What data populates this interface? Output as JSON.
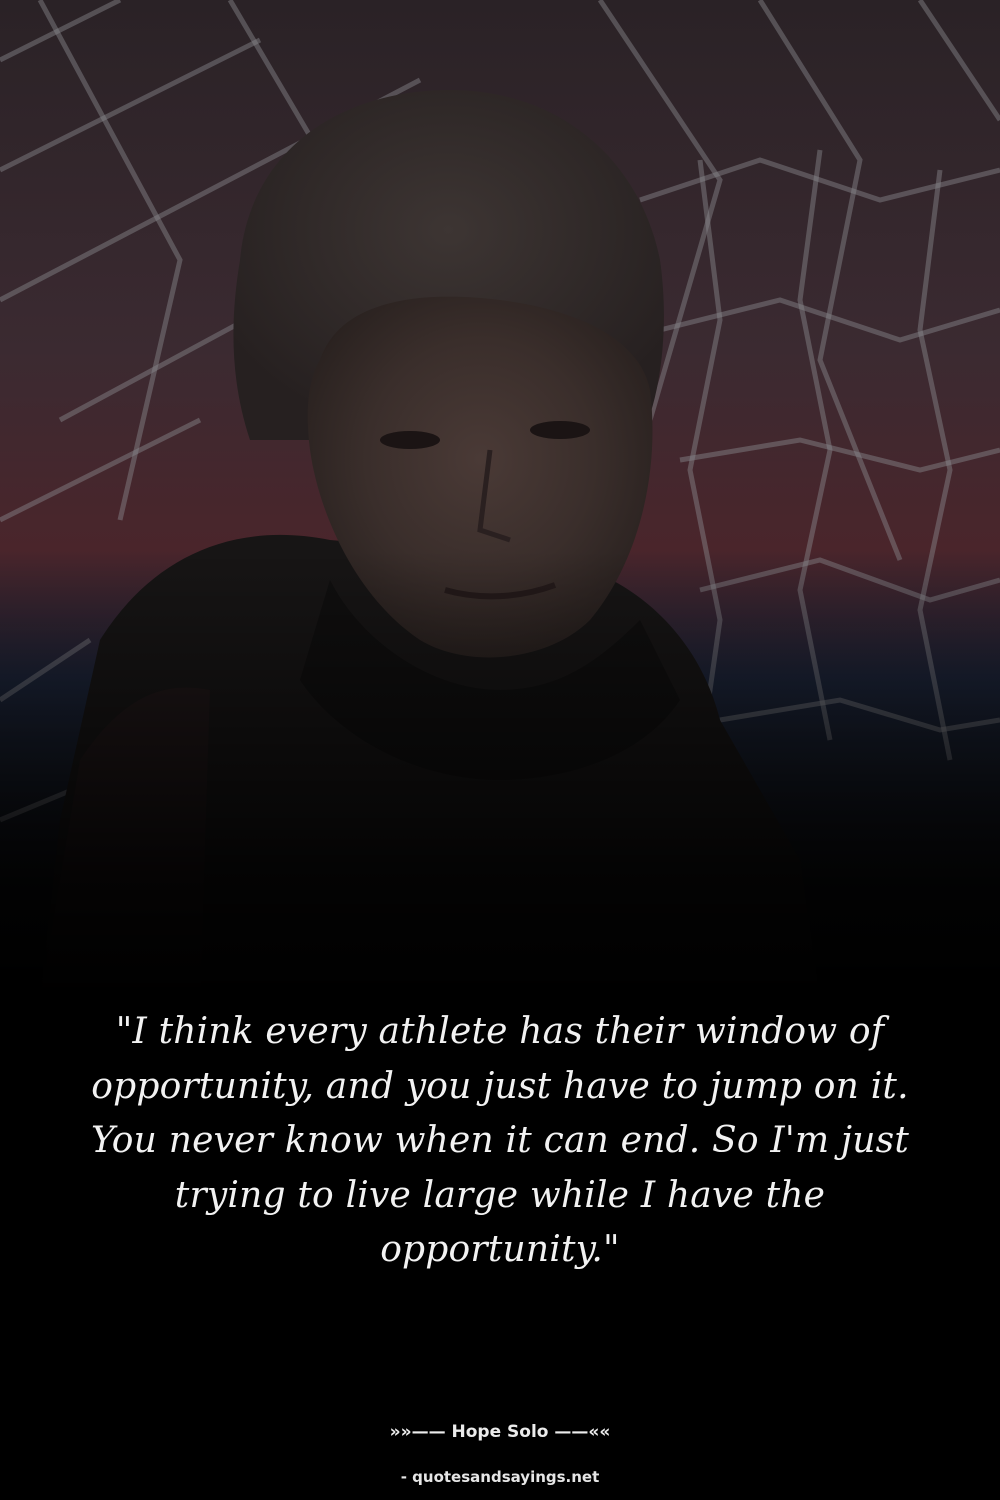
{
  "image": {
    "subject": "portrait-photo",
    "colors": {
      "background": "#000000",
      "upper_wall": "#3a2a30",
      "red_band": "#5a2228",
      "blue_band": "#1d2a44",
      "net": "#c9c9c9",
      "text": "#f2f2f2"
    }
  },
  "quote": {
    "text": "\"I think every athlete has their window of opportunity, and you just have to jump on it. You never know when it can end. So I'm just trying to live large while I have the opportunity.\""
  },
  "attribution": {
    "author_line": "»»—— Hope Solo ——««"
  },
  "source": {
    "label": "- quotesandsayings.net"
  }
}
